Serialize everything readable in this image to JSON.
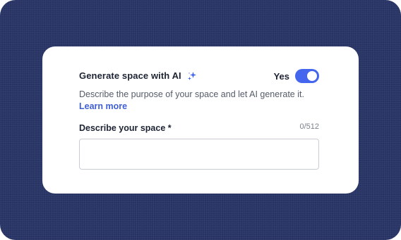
{
  "card": {
    "title": "Generate space with AI",
    "sparkle_icon": "sparkle-icon",
    "toggle": {
      "label": "Yes",
      "state": "on",
      "color": "#4466ee"
    },
    "description": "Describe the purpose of your space and let AI generate it.",
    "learn_more": "Learn more"
  },
  "field": {
    "label": "Describe your space *",
    "counter": "0/512",
    "value": "",
    "placeholder": ""
  },
  "colors": {
    "background": "#283566",
    "card": "#ffffff",
    "accent": "#4466ee",
    "link": "#3f5fd6"
  }
}
